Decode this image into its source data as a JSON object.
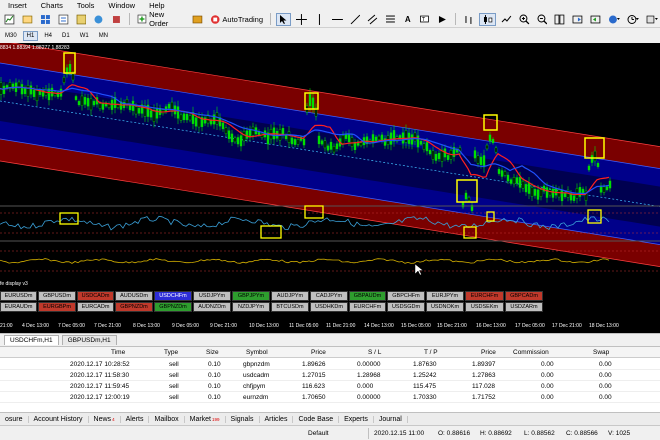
{
  "menu": [
    "Insert",
    "Charts",
    "Tools",
    "Window",
    "Help"
  ],
  "toolbar": {
    "new_order": "New Order",
    "auto_trading": "AutoTrading"
  },
  "timeframes": [
    "M30",
    "H1",
    "H4",
    "D1",
    "W1",
    "MN"
  ],
  "active_timeframe": "H1",
  "chart": {
    "ohlc_text": "8834 1.88394 1.88277 1.88283",
    "indicator_label": "fe display v3",
    "symbols_row1": [
      {
        "name": "EURUSDm",
        "color": "#c0c0c0"
      },
      {
        "name": "GBPUSDm",
        "color": "#c0c0c0"
      },
      {
        "name": "USDCADm",
        "color": "#c0392b"
      },
      {
        "name": "AUDUSDm",
        "color": "#c0c0c0"
      },
      {
        "name": "USDCHFm",
        "color": "#2d2dd8"
      },
      {
        "name": "USDJPYm",
        "color": "#c0c0c0"
      },
      {
        "name": "GBPJPYm",
        "color": "#2e9e2e"
      },
      {
        "name": "AUDJPYm",
        "color": "#c0c0c0"
      },
      {
        "name": "CADJPYm",
        "color": "#c0c0c0"
      },
      {
        "name": "GBPAUDm",
        "color": "#2e9e2e"
      },
      {
        "name": "GBPCHFm",
        "color": "#c0c0c0"
      },
      {
        "name": "EURJPYm",
        "color": "#c0c0c0"
      },
      {
        "name": "EURCHFm",
        "color": "#c0392b"
      },
      {
        "name": "GBPCADm",
        "color": "#c0392b"
      }
    ],
    "symbols_row2": [
      {
        "name": "EURAUDm",
        "color": "#c0c0c0"
      },
      {
        "name": "EURGBPm",
        "color": "#c0392b"
      },
      {
        "name": "EURCADm",
        "color": "#c0c0c0"
      },
      {
        "name": "GBPNZDm",
        "color": "#c0392b"
      },
      {
        "name": "GBPNZDm",
        "color": "#2e9e2e"
      },
      {
        "name": "AUDNZDm",
        "color": "#c0c0c0"
      },
      {
        "name": "NZDJPYm",
        "color": "#c0c0c0"
      },
      {
        "name": "BTCUSDm",
        "color": "#c0c0c0"
      },
      {
        "name": "USDHKDm",
        "color": "#c0c0c0"
      },
      {
        "name": "EURCHFm",
        "color": "#c0c0c0"
      },
      {
        "name": "USDSGDm",
        "color": "#c0c0c0"
      },
      {
        "name": "USDNOKm",
        "color": "#c0c0c0"
      },
      {
        "name": "USDSEKm",
        "color": "#c0c0c0"
      },
      {
        "name": "USDZARm",
        "color": "#c0c0c0"
      }
    ],
    "time_labels": [
      "21:00",
      "4 Dec 13:00",
      "7 Dec 05:00",
      "7 Dec 21:00",
      "8 Dec 13:00",
      "9 Dec 05:00",
      "9 Dec 21:00",
      "10 Dec 13:00",
      "11 Dec 05:00",
      "11 Dec 21:00",
      "14 Dec 13:00",
      "15 Dec 05:00",
      "15 Dec 21:00",
      "16 Dec 13:00",
      "17 Dec 05:00",
      "17 Dec 21:00",
      "18 Dec 13:00"
    ]
  },
  "chart_tabs": [
    "USDCHFm,H1",
    "GBPUSDm,H1"
  ],
  "active_chart_tab": "USDCHFm,H1",
  "terminal": {
    "columns": [
      "Time",
      "Type",
      "Size",
      "Symbol",
      "Price",
      "S / L",
      "T / P",
      "Price",
      "Commission",
      "Swap"
    ],
    "rows": [
      {
        "time": "2020.12.17 10:28:52",
        "type": "sell",
        "size": "0.10",
        "symbol": "gbpnzdm",
        "price": "1.89626",
        "sl": "0.00000",
        "tp": "1.87630",
        "cur": "1.89397",
        "commission": "0.00",
        "swap": "0.00"
      },
      {
        "time": "2020.12.17 11:58:30",
        "type": "sell",
        "size": "0.10",
        "symbol": "usdcadm",
        "price": "1.27015",
        "sl": "1.28968",
        "tp": "1.25242",
        "cur": "1.27863",
        "commission": "0.00",
        "swap": "0.00"
      },
      {
        "time": "2020.12.17 11:59:45",
        "type": "sell",
        "size": "0.10",
        "symbol": "chfjpym",
        "price": "116.623",
        "sl": "0.000",
        "tp": "115.475",
        "cur": "117.028",
        "commission": "0.00",
        "swap": "0.00"
      },
      {
        "time": "2020.12.17 12:00:19",
        "type": "sell",
        "size": "0.10",
        "symbol": "eurnzdm",
        "price": "1.70650",
        "sl": "0.00000",
        "tp": "1.70330",
        "cur": "1.71752",
        "commission": "0.00",
        "swap": "0.00"
      }
    ]
  },
  "bottom_tabs": [
    {
      "label": "osure",
      "badge": ""
    },
    {
      "label": "Account History",
      "badge": ""
    },
    {
      "label": "News",
      "badge": "4"
    },
    {
      "label": "Alerts",
      "badge": ""
    },
    {
      "label": "Mailbox",
      "badge": ""
    },
    {
      "label": "Market",
      "badge": "199"
    },
    {
      "label": "Signals",
      "badge": ""
    },
    {
      "label": "Articles",
      "badge": ""
    },
    {
      "label": "Code Base",
      "badge": ""
    },
    {
      "label": "Experts",
      "badge": ""
    },
    {
      "label": "Journal",
      "badge": ""
    }
  ],
  "status": {
    "profile": "Default",
    "datetime": "2020.12.15 11:00",
    "open": "O: 0.88616",
    "high": "H: 0.88692",
    "low": "L: 0.88562",
    "close": "C: 0.88566",
    "volume": "V: 1025"
  },
  "colors": {
    "candle": "#00e000",
    "ma_red": "#ff2020",
    "ma_blue": "#2050ff",
    "channel_fill": "#7a0000",
    "channel_inner": "#00008a",
    "highlight_box": "#ffff00",
    "oscillator": "#3aa0d8",
    "indicator_gold": "#d4b000"
  }
}
